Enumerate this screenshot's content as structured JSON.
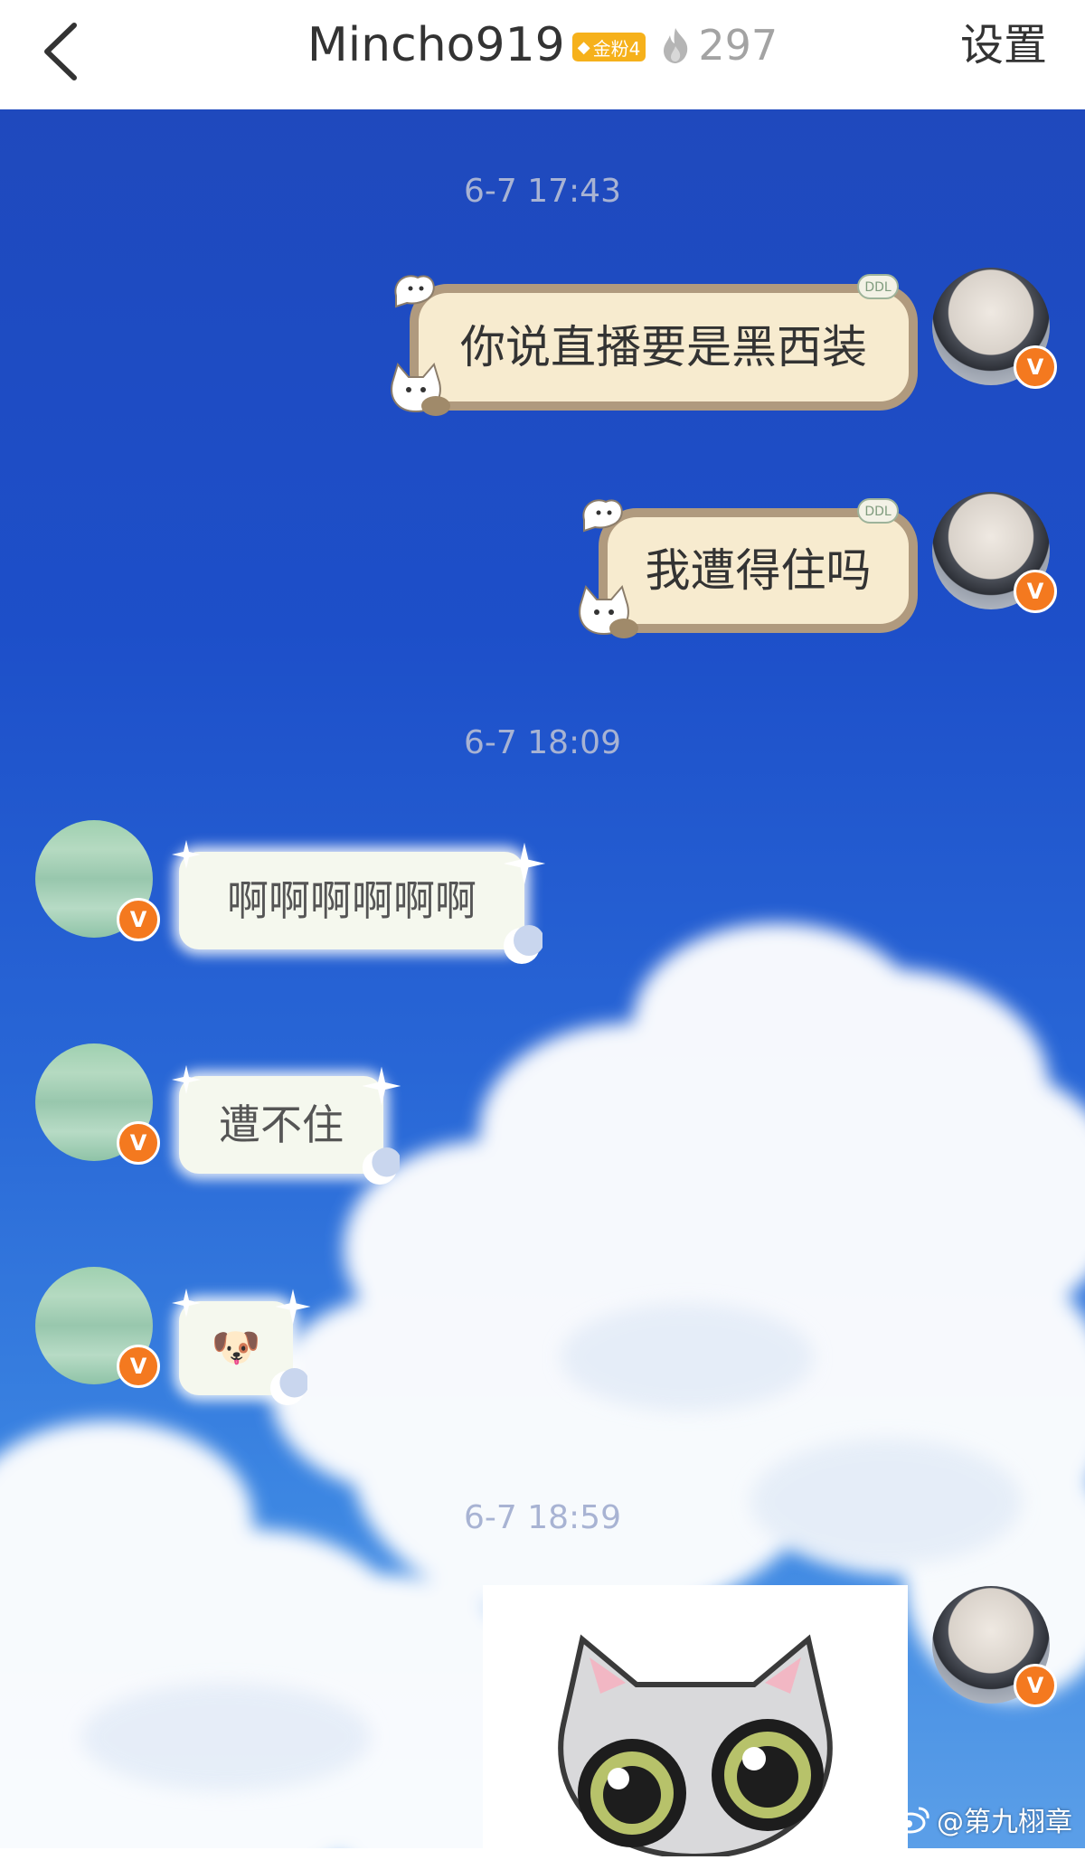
{
  "header": {
    "back_icon": "chevron-left-icon",
    "title": "Mincho919",
    "fan_badge": "金粉4",
    "heat_icon": "flame-icon",
    "heat_value": "297",
    "settings_label": "设置"
  },
  "colors": {
    "badge": "#f6b11b",
    "verified": "#f4791f",
    "sky": "#1f49bd",
    "bubble_brown": "#b09a7e",
    "bubble_fill": "#f7ebcf"
  },
  "chat": {
    "timestamps": [
      "6-7 17:43",
      "6-7 18:09",
      "6-7 18:59"
    ],
    "messages": [
      {
        "side": "right",
        "text": "你说直播要是黑西装",
        "tag": "DDL"
      },
      {
        "side": "right",
        "text": "我遭得住吗",
        "tag": "DDL"
      },
      {
        "side": "left",
        "text": "啊啊啊啊啊啊"
      },
      {
        "side": "left",
        "text": "遭不住"
      },
      {
        "side": "left",
        "emoji": "🐶"
      },
      {
        "side": "right",
        "type": "sticker"
      }
    ],
    "verified_mark": "V"
  },
  "watermark": "@第九栩章"
}
